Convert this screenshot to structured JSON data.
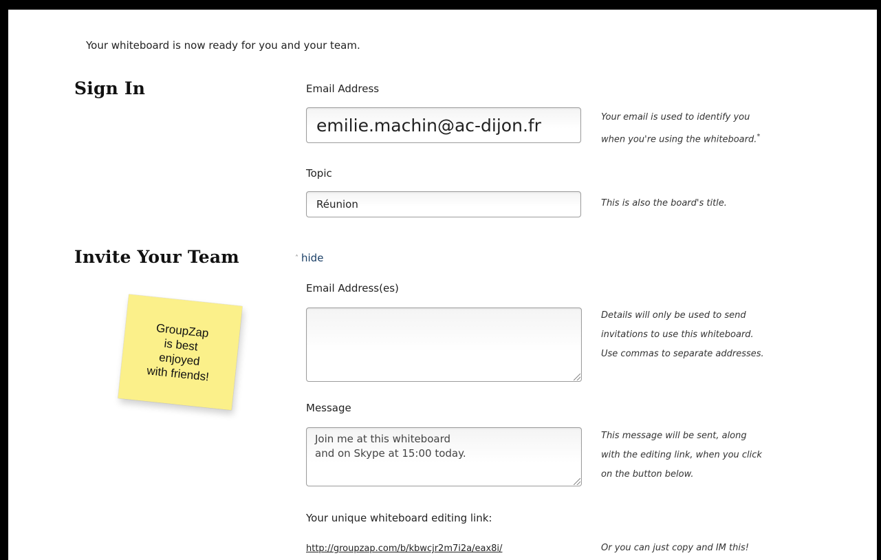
{
  "intro": "Your whiteboard is now ready for you and your team.",
  "sign_in": {
    "heading": "Sign In",
    "email_label": "Email Address",
    "email_value": "emilie.machin@ac-dijon.fr",
    "email_hint_line1": "Your email is used to identify you",
    "email_hint_line2": "when you're using the whiteboard.",
    "email_hint_mark": "*",
    "topic_label": "Topic",
    "topic_value": "Réunion",
    "topic_hint": "This is also the board's title."
  },
  "invite": {
    "heading": "Invite Your Team",
    "hide_label": "hide",
    "sticky_lines": [
      "GroupZap",
      "is best",
      "enjoyed",
      "with friends!"
    ],
    "emails_label": "Email Address(es)",
    "emails_value": "",
    "emails_hint": [
      "Details will only be used to send",
      "invitations to use this whiteboard.",
      "Use commas to separate addresses."
    ],
    "message_label": "Message",
    "message_value": "Join me at this whiteboard\nand on Skype at 15:00 today.",
    "message_hint": [
      "This message will be sent, along",
      "with the editing link, when you click",
      "on the button below."
    ],
    "link_label": "Your unique whiteboard editing link:",
    "link_url": "http://groupzap.com/b/kbwcjr2m7i2a/eax8i/",
    "link_hint": "Or you can just copy and IM this!"
  },
  "colors": {
    "sticky": "#fbf08a",
    "link": "#1a3f66",
    "frame": "#000000"
  }
}
